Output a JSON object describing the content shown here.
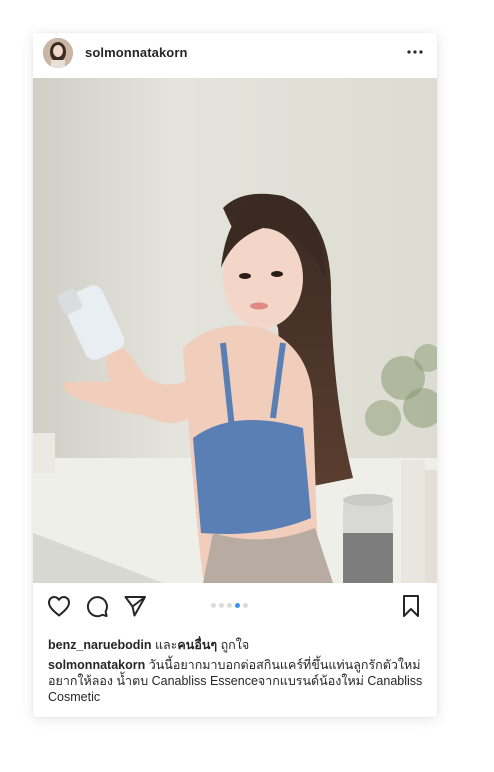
{
  "post": {
    "username": "solmonnatakorn",
    "more_icon": "ellipsis-horizontal",
    "photo_alt": "Woman in blue halter top holding a clear serum bottle",
    "carousel": {
      "count": 5,
      "active_index": 3
    },
    "icons": [
      "heart-icon",
      "comment-icon",
      "share-icon",
      "bookmark-icon"
    ],
    "likes": {
      "user": "benz_naruebodin",
      "and_text": "และ",
      "others": "คนอื่นๆ",
      "suffix": "ถูกใจ"
    },
    "caption": {
      "user": "solmonnatakorn",
      "text": "วันนี้อยากมาบอกต่อสกินแคร์ที่ขึ้นแท่นลูกรักตัวใหม่ อยากให้ลอง น้ำตบ Canabliss Essenceจากแบรนด์น้องใหม่ Canabliss Cosmetic"
    }
  },
  "colors": {
    "accent": "#3897f0",
    "text": "#262626",
    "dot_inactive": "#dbdbdb",
    "top_color": "#5a7fb5"
  }
}
